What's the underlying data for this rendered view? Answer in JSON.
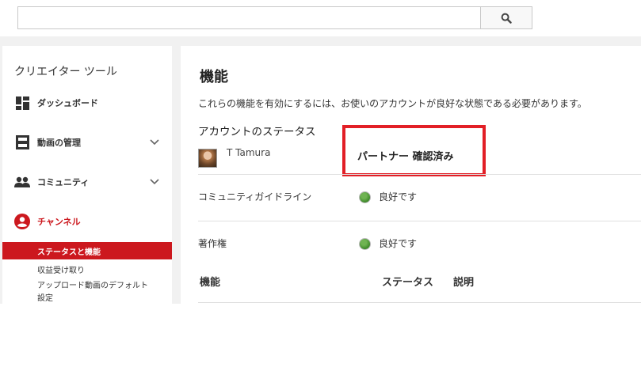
{
  "search": {
    "value": "",
    "placeholder": ""
  },
  "sidebar": {
    "title": "クリエイター ツール",
    "items": [
      {
        "label": "ダッシュボード",
        "icon": "dashboard-icon"
      },
      {
        "label": "動画の管理",
        "icon": "video-manager-icon",
        "expandable": true
      },
      {
        "label": "コミュニティ",
        "icon": "community-icon",
        "expandable": true
      },
      {
        "label": "チャンネル",
        "icon": "channel-icon",
        "active": true
      }
    ],
    "subitems": [
      {
        "label": "ステータスと機能",
        "active": true
      },
      {
        "label": "収益受け取り"
      },
      {
        "label": "アップロード動画のデフォルト設定"
      }
    ]
  },
  "main": {
    "title": "機能",
    "description": "これらの機能を有効にするには、お使いのアカウントが良好な状態である必要があります。",
    "account_status_heading": "アカウントのステータス",
    "user_name": "T Tamura",
    "partner_status": "パートナー 確認済み",
    "rows": [
      {
        "label": "コミュニティガイドライン",
        "status": "良好です"
      },
      {
        "label": "著作権",
        "status": "良好です"
      }
    ],
    "table_headers": {
      "feature": "機能",
      "status": "ステータス",
      "description": "説明"
    }
  },
  "colors": {
    "accent": "#cc181e",
    "highlight_box": "#e21f26",
    "good_status": "#3e8a2a"
  }
}
